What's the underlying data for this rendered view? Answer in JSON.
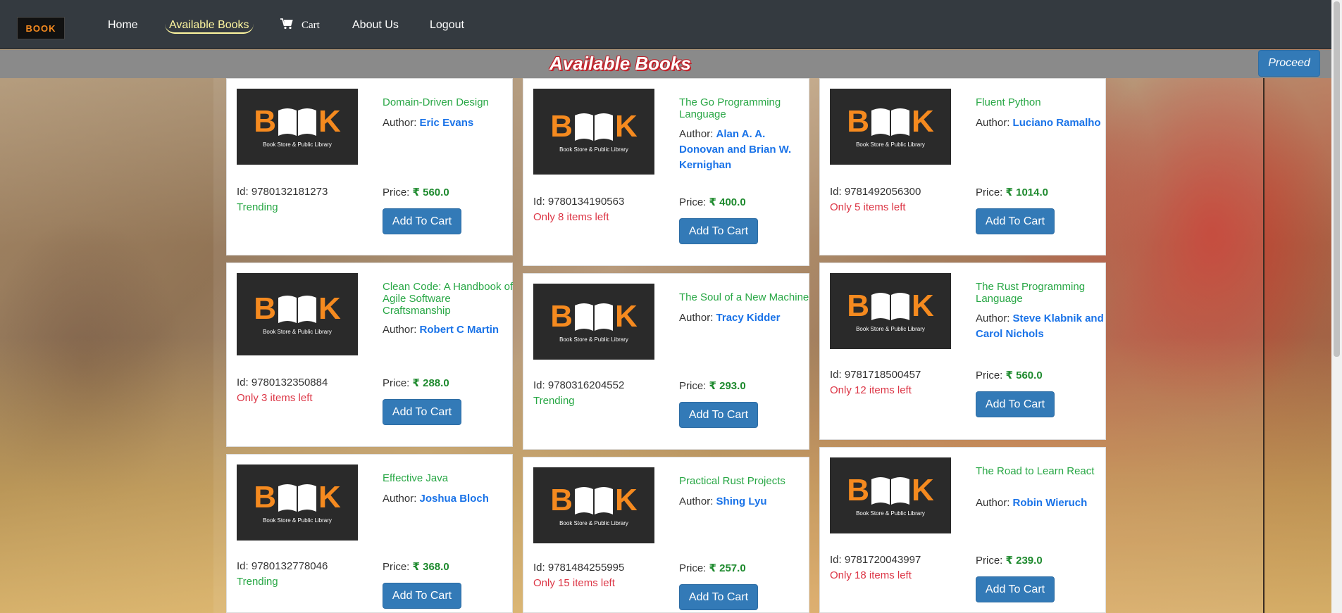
{
  "nav": {
    "logo_text": "BOOK",
    "links": [
      "Home",
      "Available Books",
      "Cart",
      "About Us",
      "Logout"
    ],
    "active": "Available Books"
  },
  "header": {
    "title": "Available Books",
    "proceed_label": "Proceed"
  },
  "labels": {
    "author": "Author:",
    "id": "Id:",
    "price": "Price:",
    "currency": "₹",
    "add_to_cart": "Add To Cart"
  },
  "cover": {
    "word_left": "B",
    "word_right": "K",
    "subtitle": "Book Store & Public Library"
  },
  "books": [
    {
      "title": "Domain-Driven Design",
      "author": "Eric Evans",
      "id": "9780132181273",
      "price": "560.0",
      "stock": "Trending",
      "stock_type": "trend"
    },
    {
      "title": "Clean Code: A Handbook of Agile Software Craftsmanship",
      "author": "Robert C Martin",
      "id": "9780132350884",
      "price": "288.0",
      "stock": "Only 3 items left",
      "stock_type": "low"
    },
    {
      "title": "Effective Java",
      "author": "Joshua Bloch",
      "id": "9780132778046",
      "price": "368.0",
      "stock": "Trending",
      "stock_type": "trend"
    },
    {
      "title": "The Go Programming Language",
      "author": "Alan A. A. Donovan and Brian W. Kernighan",
      "id": "9780134190563",
      "price": "400.0",
      "stock": "Only 8 items left",
      "stock_type": "low"
    },
    {
      "title": "The Soul of a New Machine",
      "author": "Tracy Kidder",
      "id": "9780316204552",
      "price": "293.0",
      "stock": "Trending",
      "stock_type": "trend"
    },
    {
      "title": "Practical Rust Projects",
      "author": "Shing Lyu",
      "id": "9781484255995",
      "price": "257.0",
      "stock": "Only 15 items left",
      "stock_type": "low"
    },
    {
      "title": "Fluent Python",
      "author": "Luciano Ramalho",
      "id": "9781492056300",
      "price": "1014.0",
      "stock": "Only 5 items left",
      "stock_type": "low"
    },
    {
      "title": "The Rust Programming Language",
      "author": "Steve Klabnik and Carol Nichols",
      "id": "9781718500457",
      "price": "560.0",
      "stock": "Only 12 items left",
      "stock_type": "low"
    },
    {
      "title": "The Road to Learn React",
      "author": "Robin Wieruch",
      "id": "9781720043997",
      "price": "239.0",
      "stock": "Only 18 items left",
      "stock_type": "low"
    }
  ]
}
